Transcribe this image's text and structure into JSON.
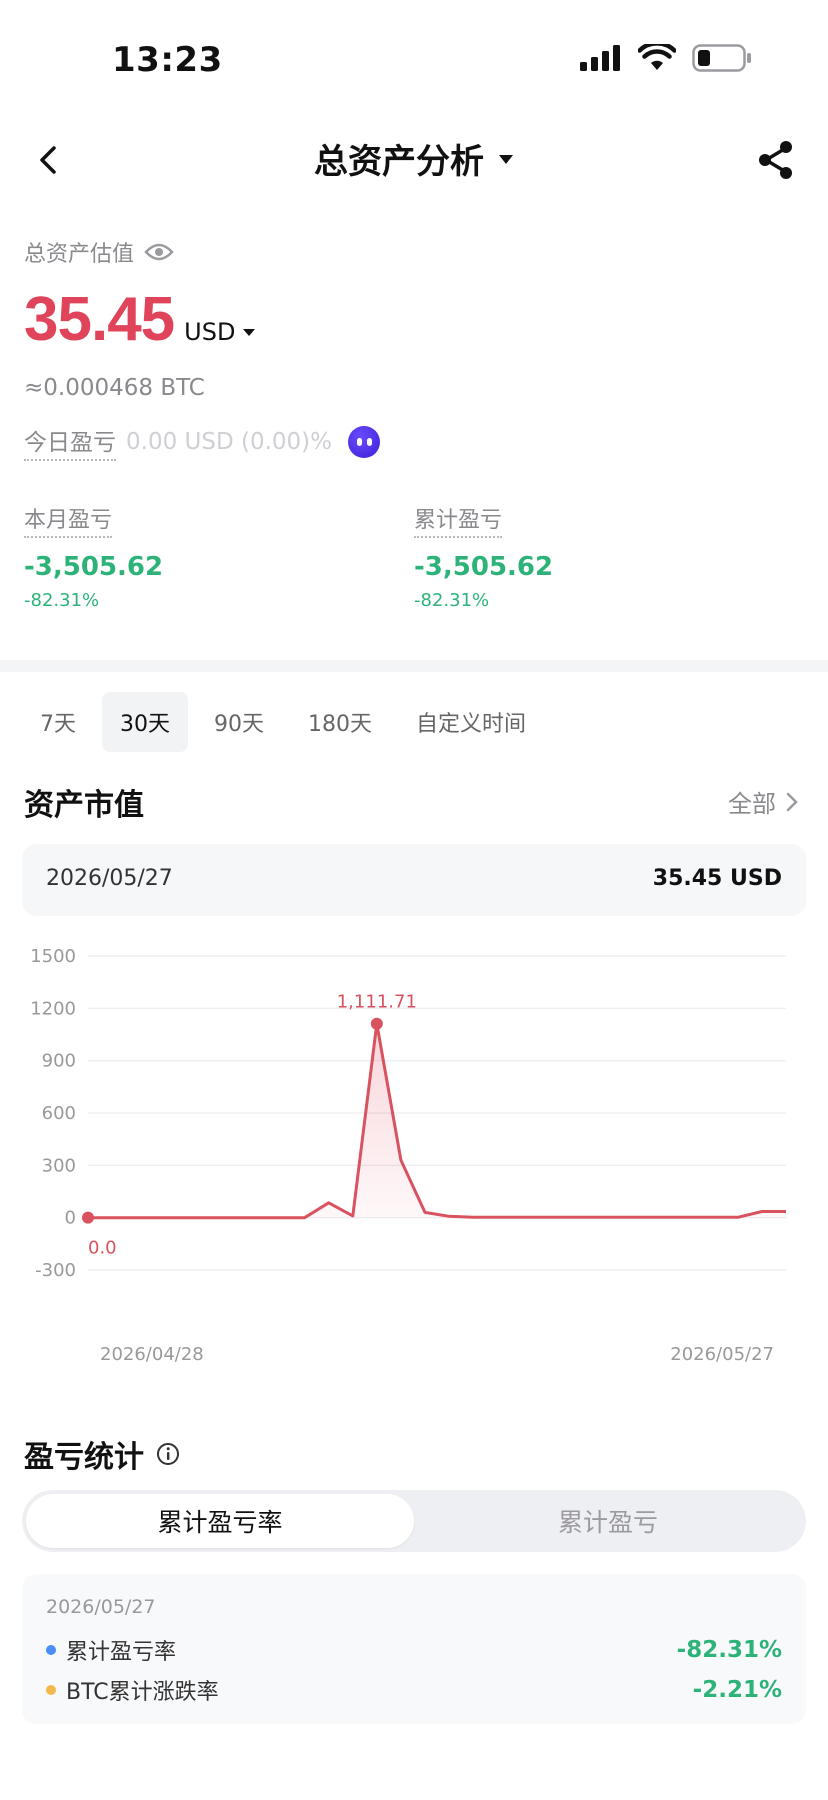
{
  "status": {
    "time": "13:23"
  },
  "header": {
    "title": "总资产分析"
  },
  "summary": {
    "label": "总资产估值",
    "value": "35.45",
    "currency": "USD",
    "btc": "≈0.000468 BTC",
    "today_label": "今日盈亏",
    "today_value": "0.00 USD (0.00)%"
  },
  "pl": {
    "month": {
      "label": "本月盈亏",
      "value": "-3,505.62",
      "pct": "-82.31%"
    },
    "total": {
      "label": "累计盈亏",
      "value": "-3,505.62",
      "pct": "-82.31%"
    }
  },
  "range_tabs": [
    "7天",
    "30天",
    "90天",
    "180天",
    "自定义时间"
  ],
  "range_active": "30天",
  "market": {
    "title": "资产市值",
    "all_label": "全部",
    "card_date": "2026/05/27",
    "card_value": "35.45 USD"
  },
  "colors": {
    "accent_red": "#e0445a",
    "line_red": "#d9525f",
    "green": "#2db37a",
    "blue": "#4a8ef5",
    "yellow": "#f2b84b"
  },
  "chart_data": {
    "type": "area",
    "ylim": [
      -300,
      1500
    ],
    "yticks": [
      1500,
      1200,
      900,
      600,
      300,
      0,
      -300
    ],
    "x_start_label": "2026/04/28",
    "x_end_label": "2026/05/27",
    "values": [
      0,
      0,
      0,
      0,
      0,
      0,
      0,
      0,
      0,
      0,
      85,
      10,
      1111.71,
      330,
      30,
      8,
      2,
      2,
      2,
      2,
      2,
      2,
      2,
      2,
      2,
      2,
      2,
      2,
      35.45,
      35.45
    ],
    "annotations": {
      "max_label": "1,111.71",
      "start_label": "0.0"
    }
  },
  "stats": {
    "title": "盈亏统计",
    "seg_active": "累计盈亏率",
    "seg_inactive": "累计盈亏",
    "date": "2026/05/27",
    "rows": [
      {
        "label": "累计盈亏率",
        "value": "-82.31%",
        "dot_color": "#4a8ef5"
      },
      {
        "label": "BTC累计涨跌率",
        "value": "-2.21%",
        "dot_color": "#f2b84b"
      }
    ]
  }
}
